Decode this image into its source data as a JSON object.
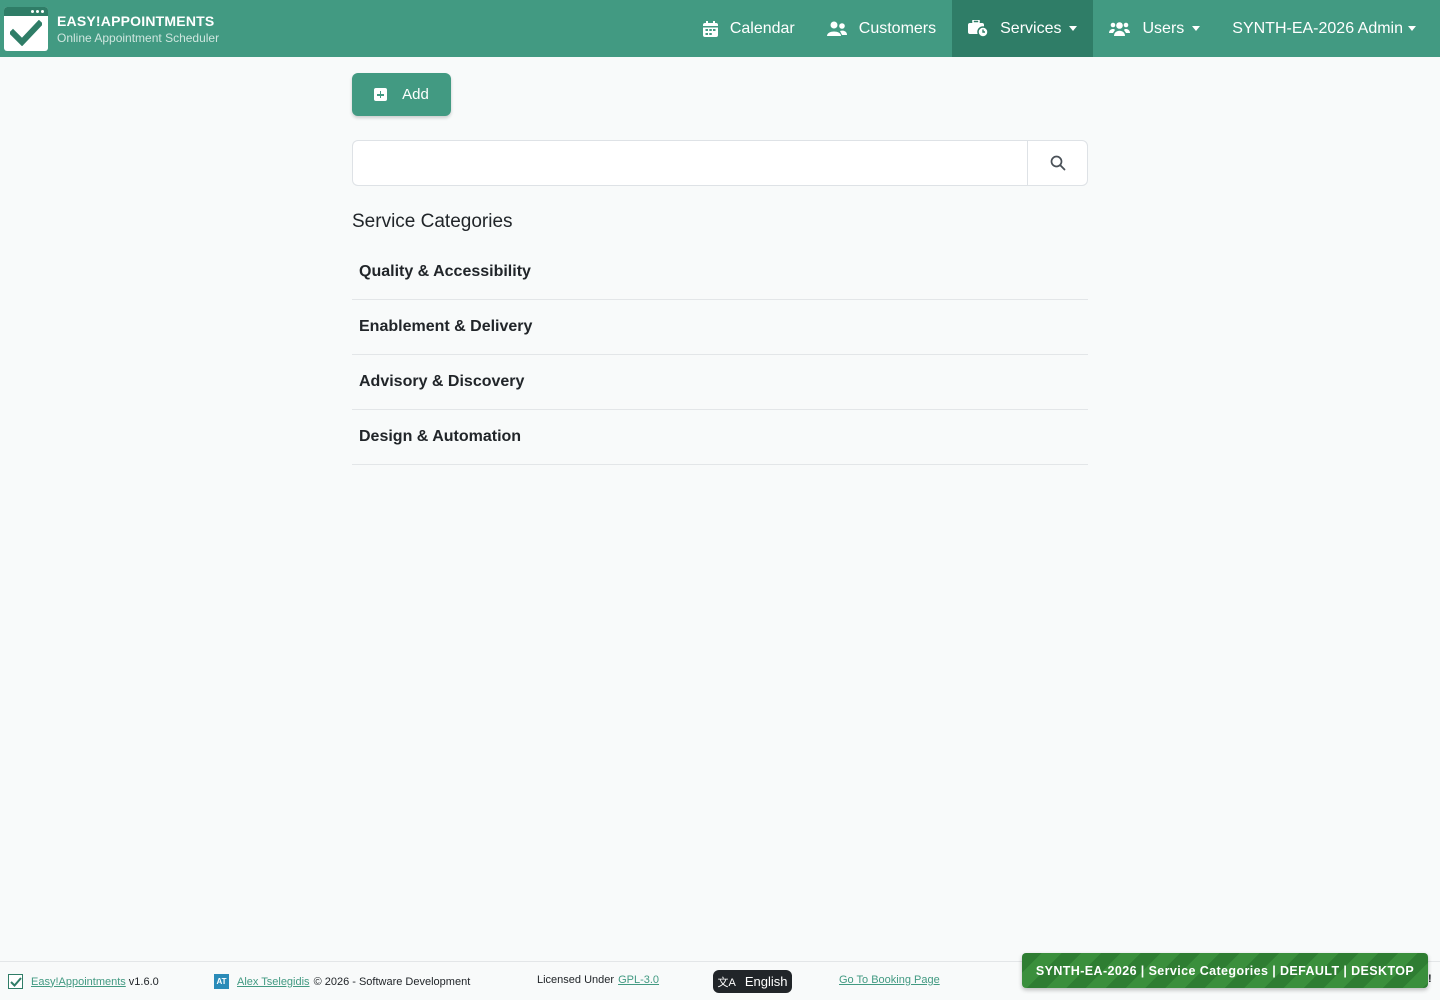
{
  "header": {
    "brand_title": "EASY!APPOINTMENTS",
    "brand_subtitle": "Online Appointment Scheduler",
    "nav": {
      "calendar": "Calendar",
      "customers": "Customers",
      "services": "Services",
      "users": "Users",
      "account": "SYNTH-EA-2026 Admin"
    },
    "active_nav": "services"
  },
  "toolbar": {
    "add_label": "Add"
  },
  "search": {
    "value": "",
    "placeholder": ""
  },
  "main": {
    "section_title": "Service Categories",
    "categories": [
      {
        "label": "Quality & Accessibility"
      },
      {
        "label": "Enablement & Delivery"
      },
      {
        "label": "Advisory & Discovery"
      },
      {
        "label": "Design & Automation"
      }
    ]
  },
  "footer": {
    "app_link": "Easy!Appointments",
    "version": "v1.6.0",
    "author_link": "Alex Tselegidis",
    "copyright": "© 2026 - Software Development",
    "license_prefix": "Licensed Under",
    "license_link": "GPL-3.0",
    "language": "English",
    "booking_link": "Go To Booking Page"
  },
  "badge": {
    "text": "SYNTH-EA-2026 | Service Categories | DEFAULT | DESKTOP",
    "trailing": "!"
  },
  "colors": {
    "brand": "#429a82",
    "brand_dark": "#2f7d67",
    "background": "#f8fafa",
    "badge": "#2e7d32"
  },
  "icons": {
    "calendar": "calendar-icon",
    "customers": "users-icon",
    "services": "briefcase-clock-icon",
    "users": "users-cog-icon",
    "search": "search-icon",
    "add": "plus-square-icon",
    "language": "language-icon"
  }
}
